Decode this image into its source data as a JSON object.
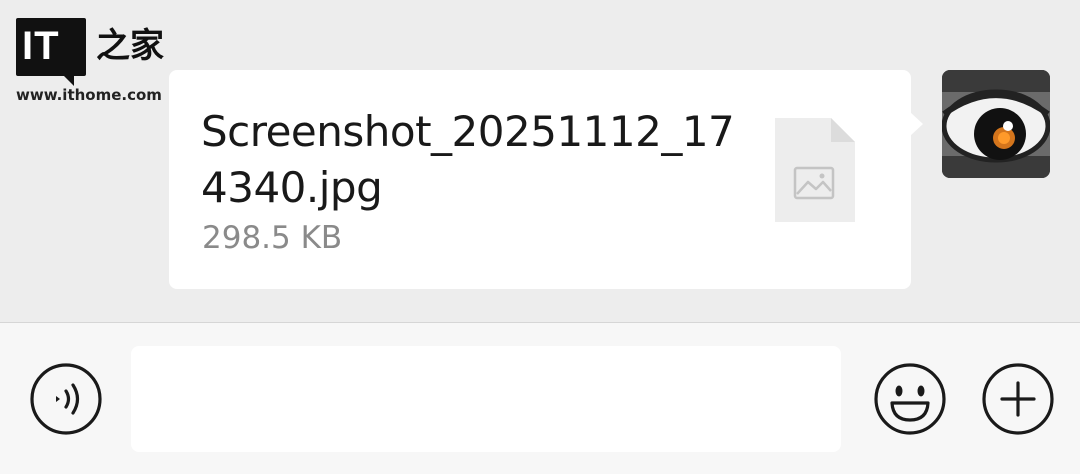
{
  "watermark": {
    "logo_text": "IT",
    "brand_cn": "之家",
    "url": "www.ithome.com"
  },
  "message": {
    "file_name": "Screenshot_20251112_174340.jpg",
    "file_size": "298.5 KB",
    "file_icon": "image-file-icon",
    "sender_avatar": "avatar-eye-image"
  },
  "input_bar": {
    "voice_icon": "voice-icon",
    "text_value": "",
    "emoji_icon": "emoji-icon",
    "more_icon": "plus-icon"
  },
  "colors": {
    "chat_bg": "#ededed",
    "bubble_bg": "#ffffff",
    "input_bar_bg": "#f7f7f7",
    "text_primary": "#191919",
    "text_secondary": "#8a8a8a"
  }
}
